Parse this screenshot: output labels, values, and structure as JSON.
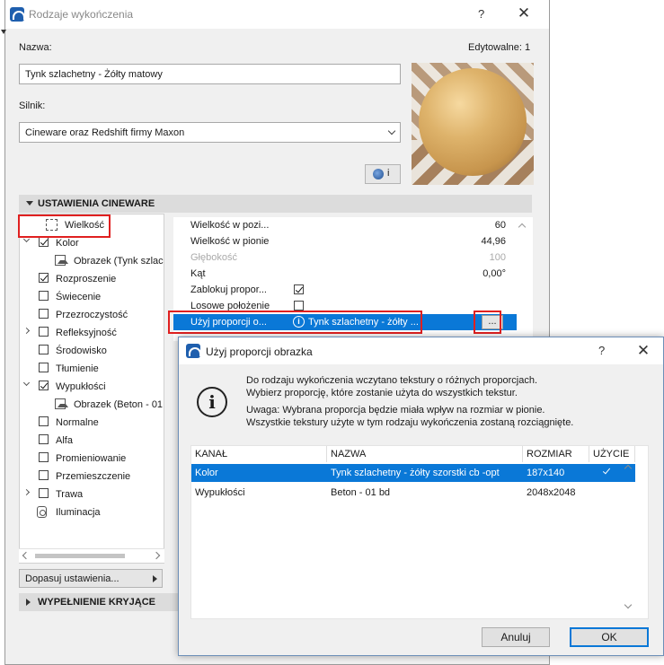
{
  "main_dialog": {
    "title": "Rodzaje wykończenia",
    "help": "?",
    "close": "✕",
    "name_label": "Nazwa:",
    "editable_label": "Edytowalne: 1",
    "name_value": "Tynk szlachetny - Żółty matowy",
    "engine_label": "Silnik:",
    "engine_value": "Cineware oraz Redshift firmy Maxon",
    "engine_info_button": "i",
    "section_cineware": "USTAWIENIA CINEWARE",
    "section_fill": "WYPEŁNIENIE KRYJĄCE",
    "adapt_button": "Dopasuj ustawienia..."
  },
  "tree": [
    {
      "label": "Wielkość",
      "icon": "size-icon",
      "check": null,
      "expand": null
    },
    {
      "label": "Kolor",
      "icon": null,
      "check": true,
      "expand": "open"
    },
    {
      "label": "Obrazek (Tynk szlache",
      "icon": "image-icon",
      "check": null,
      "expand": null
    },
    {
      "label": "Rozproszenie",
      "icon": null,
      "check": true,
      "expand": null
    },
    {
      "label": "Świecenie",
      "icon": null,
      "check": false,
      "expand": null
    },
    {
      "label": "Przezroczystość",
      "icon": null,
      "check": false,
      "expand": null
    },
    {
      "label": "Refleksyjność",
      "icon": null,
      "check": false,
      "expand": "closed"
    },
    {
      "label": "Środowisko",
      "icon": null,
      "check": false,
      "expand": null
    },
    {
      "label": "Tłumienie",
      "icon": null,
      "check": false,
      "expand": null
    },
    {
      "label": "Wypukłości",
      "icon": null,
      "check": true,
      "expand": "open"
    },
    {
      "label": "Obrazek (Beton - 01 b",
      "icon": "image-icon",
      "check": null,
      "expand": null
    },
    {
      "label": "Normalne",
      "icon": null,
      "check": false,
      "expand": null
    },
    {
      "label": "Alfa",
      "icon": null,
      "check": false,
      "expand": null
    },
    {
      "label": "Promieniowanie",
      "icon": null,
      "check": false,
      "expand": null
    },
    {
      "label": "Przemieszczenie",
      "icon": null,
      "check": false,
      "expand": null
    },
    {
      "label": "Trawa",
      "icon": null,
      "check": false,
      "expand": "closed"
    },
    {
      "label": "Iluminacja",
      "icon": "lamp-icon",
      "check": null,
      "expand": null
    }
  ],
  "properties": [
    {
      "name": "Wielkość w pozi...",
      "value": "60",
      "type": "value",
      "dim": false
    },
    {
      "name": "Wielkość w pionie",
      "value": "44,96",
      "type": "value",
      "dim": false
    },
    {
      "name": "Głębokość",
      "value": "100",
      "type": "value",
      "dim": true
    },
    {
      "name": "Kąt",
      "value": "0,00°",
      "type": "value",
      "dim": false
    },
    {
      "name": "Zablokuj propor...",
      "value": "",
      "type": "check-on",
      "dim": false
    },
    {
      "name": "Losowe położenie",
      "value": "",
      "type": "check-off",
      "dim": false
    },
    {
      "name": "Użyj proporcji o...",
      "value": "Tynk szlachetny - żółty ...",
      "type": "texture",
      "dim": false
    }
  ],
  "browse_button": "...",
  "sub_dialog": {
    "title": "Użyj proporcji obrazka",
    "help": "?",
    "close": "✕",
    "info_icon": "i",
    "msg1": "Do rodzaju wykończenia wczytano tekstury o różnych proporcjach.",
    "msg2": "Wybierz proporcję, które zostanie użyta do wszystkich tekstur.",
    "msg3": "Uwaga: Wybrana proporcja będzie miała wpływ na rozmiar w pionie.",
    "msg4": "Wszystkie tekstury użyte w tym rodzaju wykończenia zostaną rozciągnięte.",
    "columns": [
      "KANAŁ",
      "NAZWA",
      "ROZMIAR",
      "UŻYCIE"
    ],
    "rows": [
      {
        "channel": "Kolor",
        "name": "Tynk szlachetny - żółty szorstki cb -opt",
        "size": "187x140",
        "used": true
      },
      {
        "channel": "Wypukłości",
        "name": "Beton - 01 bd",
        "size": "2048x2048",
        "used": false
      }
    ],
    "cancel": "Anuluj",
    "ok": "OK"
  }
}
